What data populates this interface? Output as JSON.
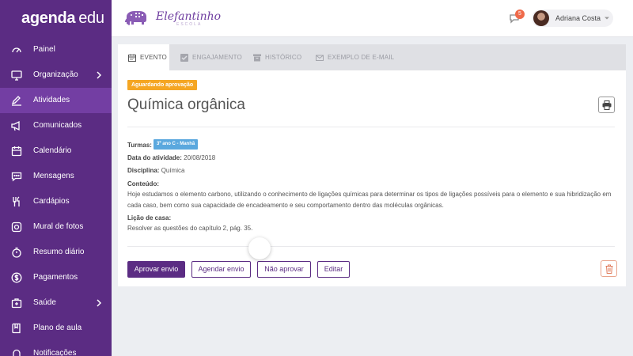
{
  "brand": {
    "part1": "agenda",
    "part2": "edu"
  },
  "sidebar": {
    "items": [
      {
        "label": "Painel",
        "icon": "speedometer-icon"
      },
      {
        "label": "Organização",
        "icon": "monitor-icon",
        "has_submenu": true
      },
      {
        "label": "Atividades",
        "icon": "pencil-icon",
        "active": true
      },
      {
        "label": "Comunicados",
        "icon": "megaphone-icon"
      },
      {
        "label": "Calendário",
        "icon": "calendar-icon"
      },
      {
        "label": "Mensagens",
        "icon": "chat-icon"
      },
      {
        "label": "Cardápios",
        "icon": "cutlery-icon"
      },
      {
        "label": "Mural de fotos",
        "icon": "camera-icon"
      },
      {
        "label": "Resumo diário",
        "icon": "stopwatch-icon"
      },
      {
        "label": "Pagamentos",
        "icon": "dollar-icon"
      },
      {
        "label": "Saúde",
        "icon": "medical-kit-icon",
        "has_submenu": true
      },
      {
        "label": "Plano de aula",
        "icon": "book-icon"
      },
      {
        "label": "Notificações",
        "icon": "bell-icon"
      }
    ]
  },
  "header": {
    "school_name": "Elefantinho",
    "school_sub": "ESCOLA",
    "notifications_count": "5",
    "user_name": "Adriana Costa"
  },
  "tabs": [
    {
      "label": "EVENTO",
      "icon": "calendar-icon",
      "active": true
    },
    {
      "label": "ENGAJAMENTO",
      "icon": "checkbox-icon"
    },
    {
      "label": "HISTÓRICO",
      "icon": "archive-icon"
    },
    {
      "label": "EXEMPLO DE E-MAIL",
      "icon": "envelope-icon"
    }
  ],
  "activity": {
    "status": "Aguardando aprovação",
    "title": "Química orgânica",
    "classes_label": "Turmas:",
    "classes_value": "3º ano C - Manhã",
    "date_label": "Data do atividade:",
    "date_value": "20/08/2018",
    "subject_label": "Disciplina:",
    "subject_value": "Química",
    "content_label": "Conteúdo:",
    "content_value": "Hoje estudamos o elemento carbono, utilizando o conhecimento de ligações químicas para determinar os tipos de ligações possíveis para o elemento e sua hibridização em cada caso, bem como sua capacidade de encadeamento e seu comportamento dentro das moléculas orgânicas.",
    "homework_label": "Lição de casa:",
    "homework_value": "Resolver as questões do capítulo 2, pág. 35."
  },
  "actions": {
    "approve": "Aprovar envio",
    "schedule": "Agendar envio",
    "reject": "Não aprovar",
    "edit": "Editar"
  },
  "colors": {
    "sidebar": "#5b2c83",
    "sidebar_active": "#733ea3",
    "status_badge": "#f5a623",
    "class_tag": "#5aa8de",
    "notification_badge": "#ef6a4a",
    "danger_outline": "#e9a48c"
  }
}
